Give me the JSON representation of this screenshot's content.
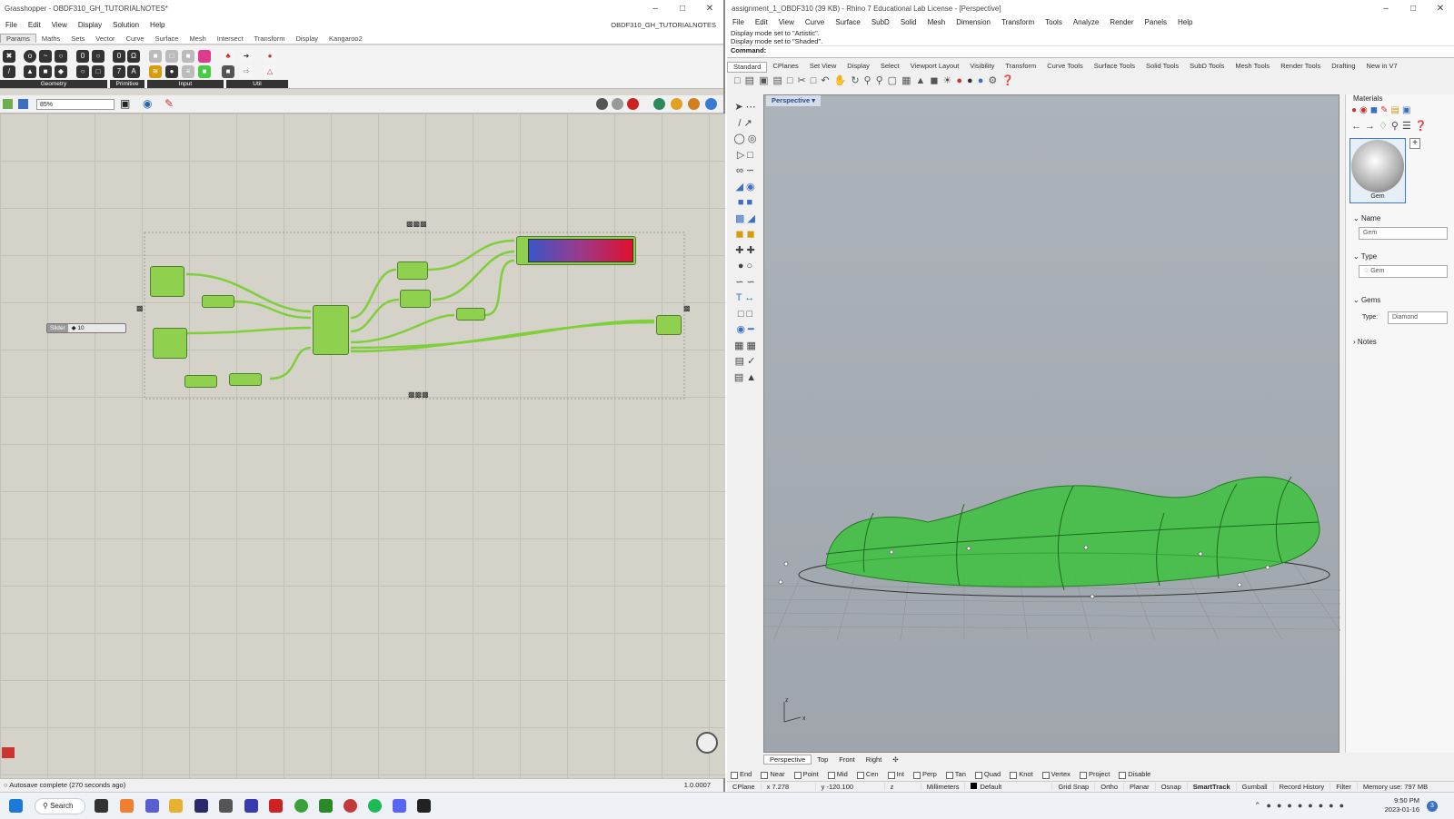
{
  "grasshopper": {
    "title": "Grasshopper - OBDF310_GH_TUTORIALNOTES*",
    "menu": [
      "File",
      "Edit",
      "View",
      "Display",
      "Solution",
      "Help"
    ],
    "doc_name": "OBDF310_GH_TUTORIALNOTES",
    "tabs": [
      "Params",
      "Maths",
      "Sets",
      "Vector",
      "Curve",
      "Surface",
      "Mesh",
      "Intersect",
      "Transform",
      "Display",
      "Kangaroo2"
    ],
    "ribbon_groups": [
      "Geometry",
      "Primitive",
      "Input",
      "Util"
    ],
    "zoom": "85%",
    "slider": {
      "label": "Slider",
      "value": "◆ 10"
    },
    "status": "Autosave complete (270 seconds ago)",
    "version": "1.0.0007"
  },
  "rhino": {
    "title": "assignment_1_OBDF310 (39 KB) - Rhino 7 Educational Lab License - [Perspective]",
    "menu": [
      "File",
      "Edit",
      "View",
      "Curve",
      "Surface",
      "SubD",
      "Solid",
      "Mesh",
      "Dimension",
      "Transform",
      "Tools",
      "Analyze",
      "Render",
      "Panels",
      "Help"
    ],
    "history": [
      "Display mode set to \"Artistic\".",
      "Display mode set to \"Shaded\"."
    ],
    "command_label": "Command:",
    "tabs": [
      "Standard",
      "CPlanes",
      "Set View",
      "Display",
      "Select",
      "Viewport Layout",
      "Visibility",
      "Transform",
      "Curve Tools",
      "Surface Tools",
      "Solid Tools",
      "SubD Tools",
      "Mesh Tools",
      "Render Tools",
      "Drafting",
      "New in V7"
    ],
    "viewport_name": "Perspective",
    "viewport_tabs": [
      "Perspective",
      "Top",
      "Front",
      "Right"
    ],
    "osnaps": [
      "End",
      "Near",
      "Point",
      "Mid",
      "Cen",
      "Int",
      "Perp",
      "Tan",
      "Quad",
      "Knot",
      "Vertex",
      "Project",
      "Disable"
    ],
    "status": {
      "cplane": "CPlane",
      "x": "x 7.278",
      "y": "y -120.100",
      "z": "z",
      "units": "Millimeters",
      "layer": "Default",
      "toggles": [
        "Grid Snap",
        "Ortho",
        "Planar",
        "Osnap",
        "SmartTrack",
        "Gumball",
        "Record History",
        "Filter"
      ],
      "memory": "Memory use: 797 MB"
    },
    "panel": {
      "title": "Materials",
      "swatch": "Gem",
      "name_label": "Name",
      "name_value": "Gem",
      "type_label": "Type",
      "type_value": "Gem",
      "gems_label": "Gems",
      "gem_type_label": "Type:",
      "gem_type_value": "Diamond",
      "notes_label": "Notes"
    },
    "axis": {
      "x": "x",
      "z": "z"
    }
  },
  "taskbar": {
    "search": "Search",
    "time": "9:50 PM",
    "date": "2023-01-16",
    "badge": "3"
  },
  "colors": {
    "gh_canvas": "#d4d2c9",
    "gh_component": "#8fd14f",
    "wire": "#7fcf3a",
    "gem_green": "#2ec02e",
    "gradient_start": "#3b55c8",
    "gradient_end": "#e0102e"
  }
}
